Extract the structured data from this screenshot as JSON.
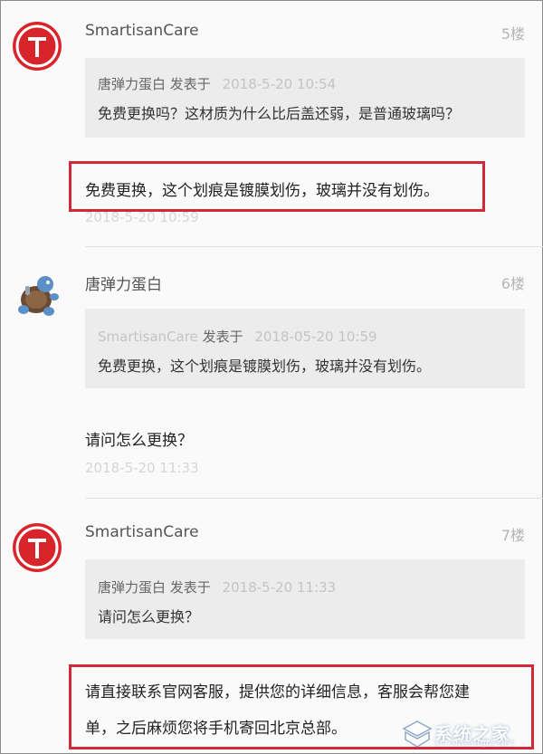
{
  "posts": [
    {
      "author": "SmartisanCare",
      "floor": "5楼",
      "quote": {
        "author": "唐弹力蛋白",
        "action": "发表于",
        "date": "2018-5-20 10:54",
        "text": "免费更换吗？这材质为什么比后盖还弱，是普通玻璃吗？"
      },
      "body": "免费更换，这个划痕是镀膜划伤，玻璃并没有划伤。",
      "date": "2018-5-20 10:59"
    },
    {
      "author": "唐弹力蛋白",
      "floor": "6楼",
      "quote": {
        "author": "SmartisanCare",
        "action": "发表于",
        "date": "2018-05-20 10:59",
        "text": "免费更换，这个划痕是镀膜划伤，玻璃并没有划伤。"
      },
      "body": "请问怎么更换？",
      "date": "2018-5-20 11:33"
    },
    {
      "author": "SmartisanCare",
      "floor": "7楼",
      "quote": {
        "author": "唐弹力蛋白",
        "action": "发表于",
        "date": "2018-5-20 11:33",
        "text": "请问怎么更换？"
      },
      "body_line1": "请直接联系官网客服，提供您的详细信息，客服会帮您建",
      "body_line2": "单，之后麻烦您将手机寄回北京总部。"
    }
  ],
  "watermark": {
    "text": "系统之家",
    "sub": "XITONGZHIJIA.NET"
  },
  "colors": {
    "accent": "#d8242b",
    "highlight": "#d1283a",
    "quote_bg": "#ececec"
  }
}
